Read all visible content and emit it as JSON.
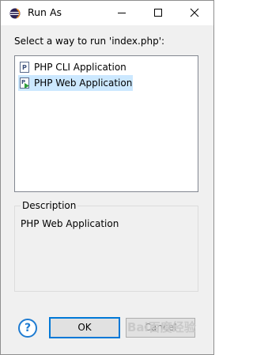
{
  "window": {
    "title": "Run As",
    "controls": {
      "minimize": "minimize",
      "maximize": "maximize",
      "close": "close"
    }
  },
  "prompt": "Select a way to run 'index.php':",
  "launchers": [
    {
      "label": "PHP CLI Application",
      "icon": "php-cli-icon",
      "selected": false
    },
    {
      "label": "PHP Web Application",
      "icon": "php-web-icon",
      "selected": true
    }
  ],
  "description": {
    "label": "Description",
    "text": "PHP Web Application"
  },
  "buttons": {
    "ok": "OK",
    "cancel": "Cancel",
    "help": "?"
  },
  "watermark": "Bai百度经验",
  "colors": {
    "selection": "#cce8ff",
    "accent": "#0078d7"
  }
}
